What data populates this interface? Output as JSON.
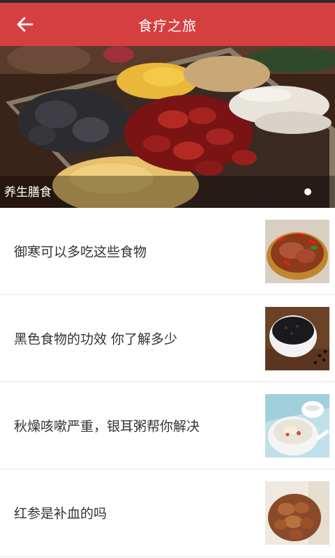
{
  "header": {
    "title": "食疗之旅",
    "back_icon": "arrow-left-icon",
    "background_color": "#d63f3f"
  },
  "banner": {
    "caption": "养生膳食",
    "slide_count": 1,
    "active_slide": 1
  },
  "articles": [
    {
      "title": "御寒可以多吃这些食物",
      "thumb_icon": "stewed-meat-with-chili-image"
    },
    {
      "title": "黑色食物的功效 你了解多少",
      "thumb_icon": "black-beans-bowl-image"
    },
    {
      "title": "秋燥咳嗽严重，银耳粥帮你解决",
      "thumb_icon": "tremella-soup-bowl-image"
    },
    {
      "title": "红参是补血的吗",
      "thumb_icon": "red-ginseng-slices-image"
    }
  ]
}
